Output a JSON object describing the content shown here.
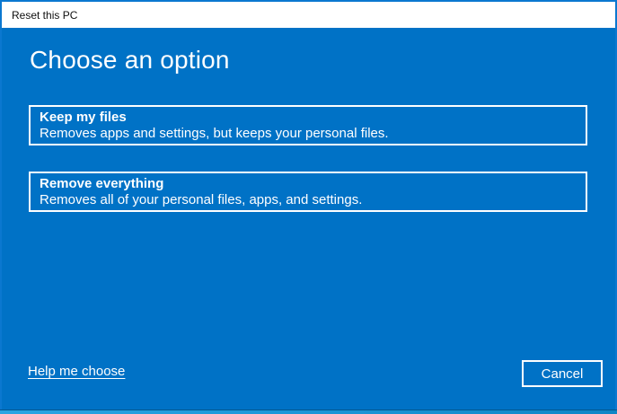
{
  "window": {
    "title": "Reset this PC"
  },
  "main": {
    "heading": "Choose an option",
    "options": [
      {
        "title": "Keep my files",
        "description": "Removes apps and settings, but keeps your personal files."
      },
      {
        "title": "Remove everything",
        "description": "Removes all of your personal files, apps, and settings."
      }
    ]
  },
  "footer": {
    "help_link_label": "Help me choose",
    "cancel_label": "Cancel"
  },
  "colors": {
    "background_blue": "#0072c6",
    "window_border_blue": "#0b78d0",
    "titlebar_background": "#ffffff",
    "titlebar_text": "#0f0f0f",
    "foreground_text": "#ffffff",
    "option_border": "#ffffff",
    "bottom_strip_left": "#2aa5e2",
    "bottom_strip_right": "#0f86c6"
  }
}
